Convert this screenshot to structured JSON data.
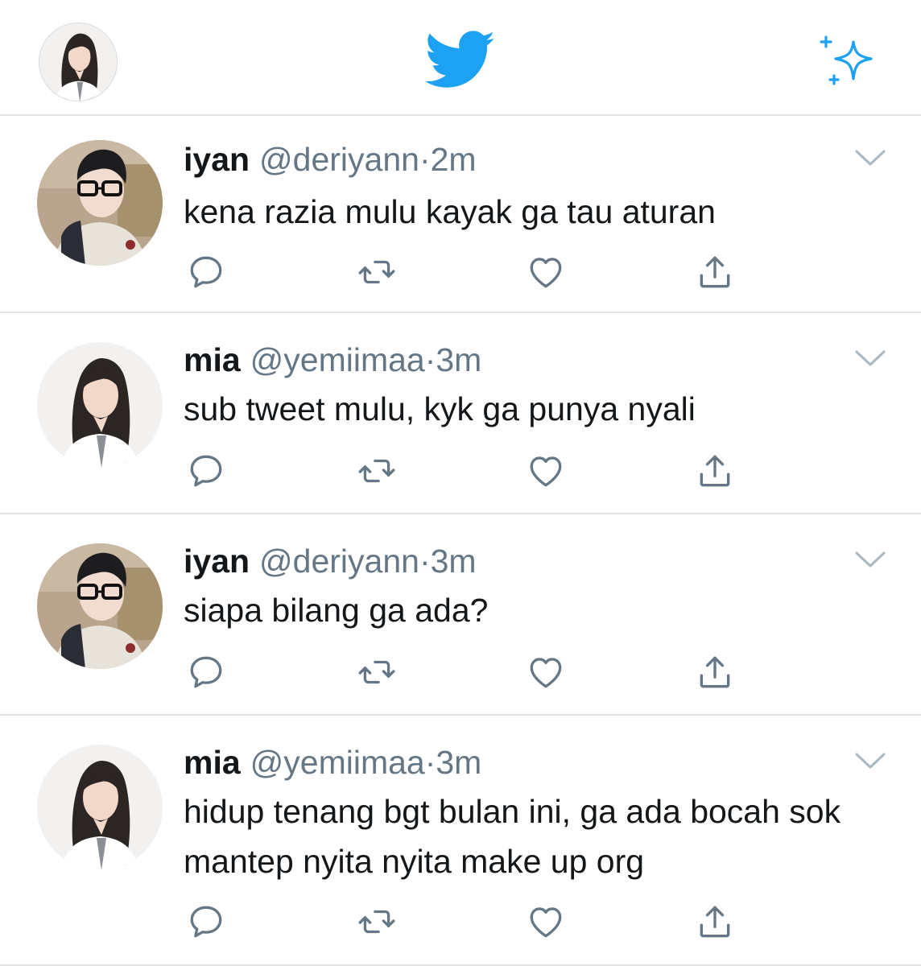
{
  "app": {
    "accent": "#1da1f2",
    "icons": {
      "logo": "twitter-bird-icon",
      "top_right": "sparkle-icon",
      "reply": "reply-icon",
      "retweet": "retweet-icon",
      "like": "heart-icon",
      "share": "share-icon",
      "menu": "chevron-down-icon"
    }
  },
  "tweets": [
    {
      "name": "iyan",
      "handle": "@deriyann",
      "dot": "·",
      "time": "2m",
      "text": "kena razia mulu kayak ga tau aturan"
    },
    {
      "name": "mia",
      "handle": "@yemiimaa",
      "dot": "·",
      "time": "3m",
      "text": "sub tweet mulu, kyk ga punya nyali"
    },
    {
      "name": "iyan",
      "handle": "@deriyann",
      "dot": "·",
      "time": "3m",
      "text": "siapa bilang ga ada?"
    },
    {
      "name": "mia",
      "handle": "@yemiimaa",
      "dot": "·",
      "time": "3m",
      "text": "hidup tenang bgt bulan ini, ga ada bocah sok mantep nyita nyita make up org"
    }
  ]
}
